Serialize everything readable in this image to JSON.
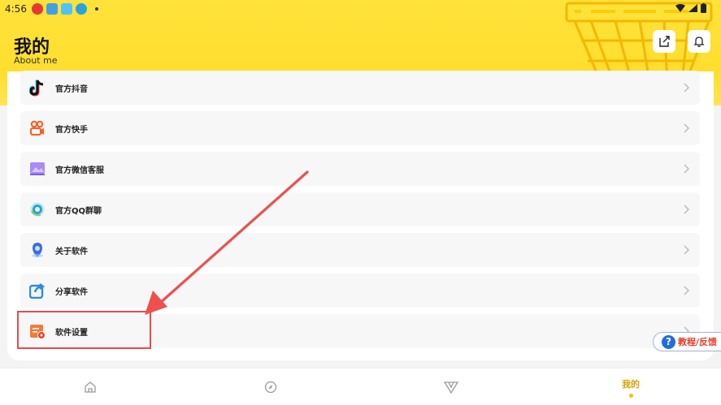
{
  "status_bar": {
    "time": "4:56",
    "icons": [
      "news-app-icon",
      "game-app-icon",
      "chat-app-icon",
      "download-icon"
    ],
    "right_icons": [
      "wifi-icon",
      "signal-icon",
      "battery-icon"
    ]
  },
  "header": {
    "title": "我的",
    "subtitle": "About me",
    "share_icon": "share-icon",
    "bell_icon": "bell-icon"
  },
  "menu": {
    "items": [
      {
        "label": "官方抖音",
        "icon": "tiktok-icon",
        "color": "#111111"
      },
      {
        "label": "官方快手",
        "icon": "kuaishou-icon",
        "color": "#ff5a1f"
      },
      {
        "label": "官方微信客服",
        "icon": "wechat-service-icon",
        "color": "#8a6cf0"
      },
      {
        "label": "官方QQ群聊",
        "icon": "qq-group-icon",
        "color": "#2aa1d8"
      },
      {
        "label": "关于软件",
        "icon": "about-icon",
        "color": "#3b6fe0"
      },
      {
        "label": "分享软件",
        "icon": "share-software-icon",
        "color": "#2e8ae6"
      },
      {
        "label": "软件设置",
        "icon": "settings-icon",
        "color": "#f25b2a"
      }
    ]
  },
  "help_button": {
    "label": "教程/反馈"
  },
  "tabbar": {
    "tabs": [
      {
        "icon": "home-icon",
        "label": ""
      },
      {
        "icon": "compass-icon",
        "label": ""
      },
      {
        "icon": "v-logo-icon",
        "label": ""
      },
      {
        "icon": "",
        "label": "我的"
      }
    ],
    "active_index": 3
  },
  "colors": {
    "header_yellow": "#ffde2e",
    "accent": "#f1c400",
    "annotation_red": "#e94a4a"
  }
}
